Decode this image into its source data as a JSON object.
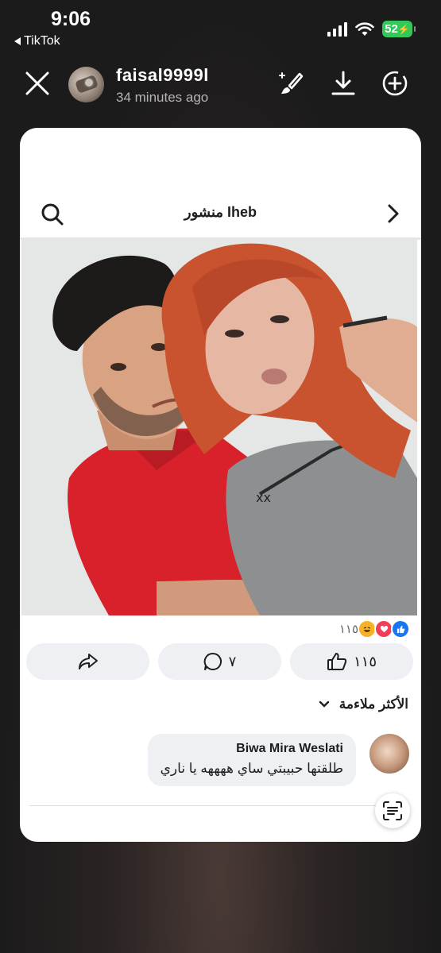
{
  "status": {
    "time": "9:06",
    "back_app": "TikTok",
    "battery": "52"
  },
  "story": {
    "username": "faisal9999l",
    "time_ago": "34 minutes ago"
  },
  "post": {
    "header_title": "منشور Iheb",
    "reaction_count": "١١٥",
    "actions": {
      "like_count": "١١٥",
      "comment_count": "٧"
    },
    "sort_label": "الأكثر ملاءمة",
    "comment": {
      "author": "Biwa Mira Weslati",
      "text": "طلقتها حبيبتي ساي ههههه يا ناري"
    }
  },
  "colors": {
    "like_blue": "#1877f2",
    "love_red": "#f33e58",
    "haha_yellow": "#f7b125",
    "battery_green": "#34c759"
  },
  "icons": [
    "close-icon",
    "brush-icon",
    "download-icon",
    "add-circle-icon",
    "search-icon",
    "chevron-right-icon",
    "share-icon",
    "comment-icon",
    "like-icon",
    "chevron-down-icon",
    "scan-text-icon"
  ]
}
